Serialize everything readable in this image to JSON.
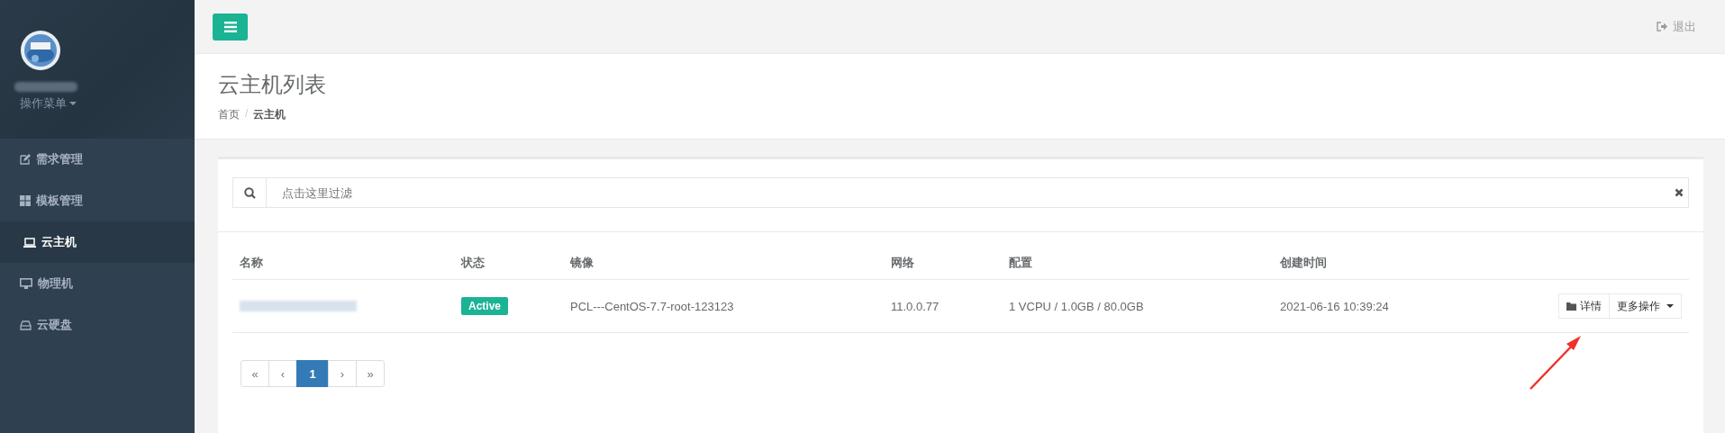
{
  "sidebar": {
    "user_menu": "操作菜单",
    "items": [
      {
        "label": "需求管理",
        "selected": false
      },
      {
        "label": "模板管理",
        "selected": false
      },
      {
        "label": "云主机",
        "selected": true
      },
      {
        "label": "物理机",
        "selected": false
      },
      {
        "label": "云硬盘",
        "selected": false
      }
    ]
  },
  "topbar": {
    "logout": "退出"
  },
  "header": {
    "title": "云主机列表",
    "breadcrumb": [
      {
        "label": "首页",
        "selected": false
      },
      {
        "label": "云主机",
        "selected": true
      }
    ],
    "separator": "/"
  },
  "search": {
    "placeholder": "点击这里过滤"
  },
  "table": {
    "columns": [
      "名称",
      "状态",
      "镜像",
      "网络",
      "配置",
      "创建时间"
    ],
    "rows": [
      {
        "status": "Active",
        "image": "PCL---CentOS-7.7-root-123123",
        "network": "11.0.0.77",
        "config": "1 VCPU / 1.0GB / 80.0GB",
        "created": "2021-06-16 10:39:24",
        "actions": [
          "详情",
          "更多操作"
        ]
      }
    ]
  },
  "pagination": [
    {
      "label": "«",
      "selected": false
    },
    {
      "label": "‹",
      "selected": false
    },
    {
      "label": "1",
      "selected": true
    },
    {
      "label": "›",
      "selected": false
    },
    {
      "label": "»",
      "selected": false
    }
  ]
}
